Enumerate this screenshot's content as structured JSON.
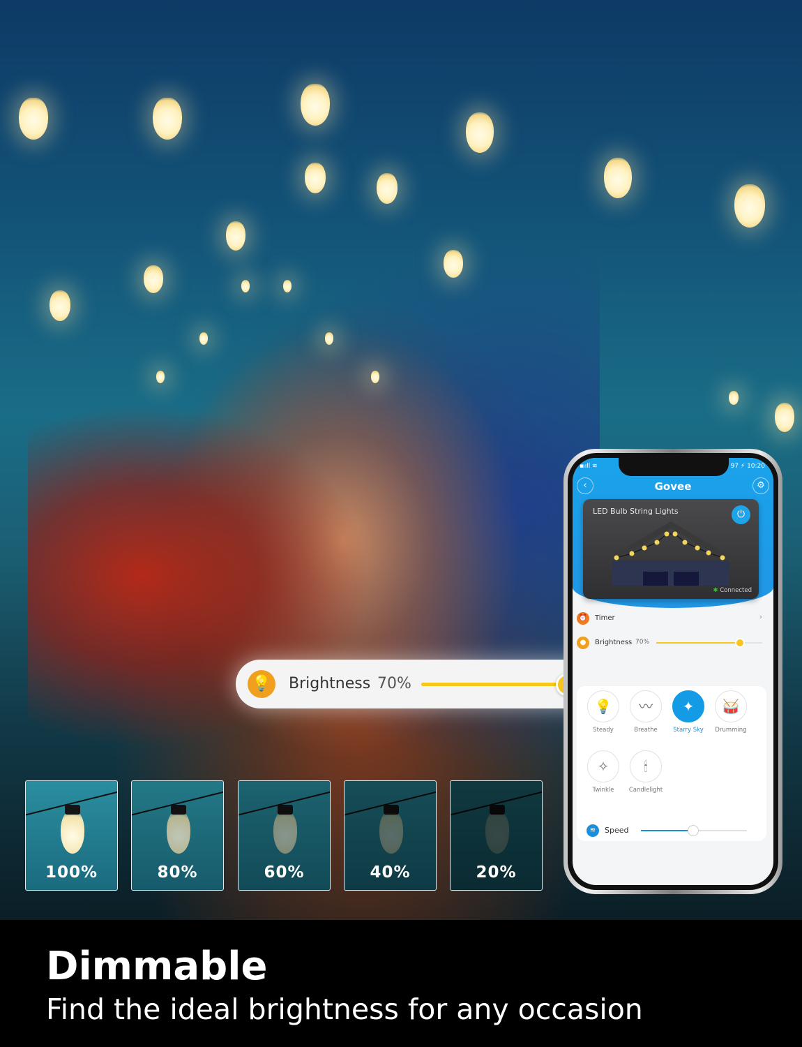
{
  "overlay_slider": {
    "label": "Brightness",
    "value": "70%",
    "level_percent": 70,
    "icon": "lightbulb-icon",
    "fill_color": "#f6c81c",
    "icon_color": "#f0a01e"
  },
  "thumbnails": [
    {
      "label": "100%",
      "level": 100
    },
    {
      "label": "80%",
      "level": 80
    },
    {
      "label": "60%",
      "level": 60
    },
    {
      "label": "40%",
      "level": 40
    },
    {
      "label": "20%",
      "level": 20
    }
  ],
  "caption": {
    "title": "Dimmable",
    "subtitle": "Find the ideal brightness for any occasion"
  },
  "phone": {
    "status": {
      "battery": "97",
      "time": "10:20"
    },
    "header": {
      "logo": "Govee",
      "back_icon": "chevron-left-icon",
      "settings_icon": "gear-icon",
      "accent": "#1aa3ea"
    },
    "device_card": {
      "name": "LED Bulb String Lights",
      "status": "Connected",
      "power_icon": "power-icon"
    },
    "timer": {
      "label": "Timer"
    },
    "brightness": {
      "label": "Brightness",
      "value": "70%",
      "level_percent": 70
    },
    "modes": [
      {
        "label": "Steady",
        "icon": "lightbulb-icon"
      },
      {
        "label": "Breathe",
        "icon": "breathe-icon"
      },
      {
        "label": "Starry Sky",
        "icon": "starry-sky-icon",
        "selected": true
      },
      {
        "label": "Drumming",
        "icon": "drum-icon"
      },
      {
        "label": "Twinkle",
        "icon": "sparkle-icon"
      },
      {
        "label": "Candlelight",
        "icon": "candle-icon"
      }
    ],
    "speed": {
      "label": "Speed",
      "level_percent": 45
    }
  }
}
